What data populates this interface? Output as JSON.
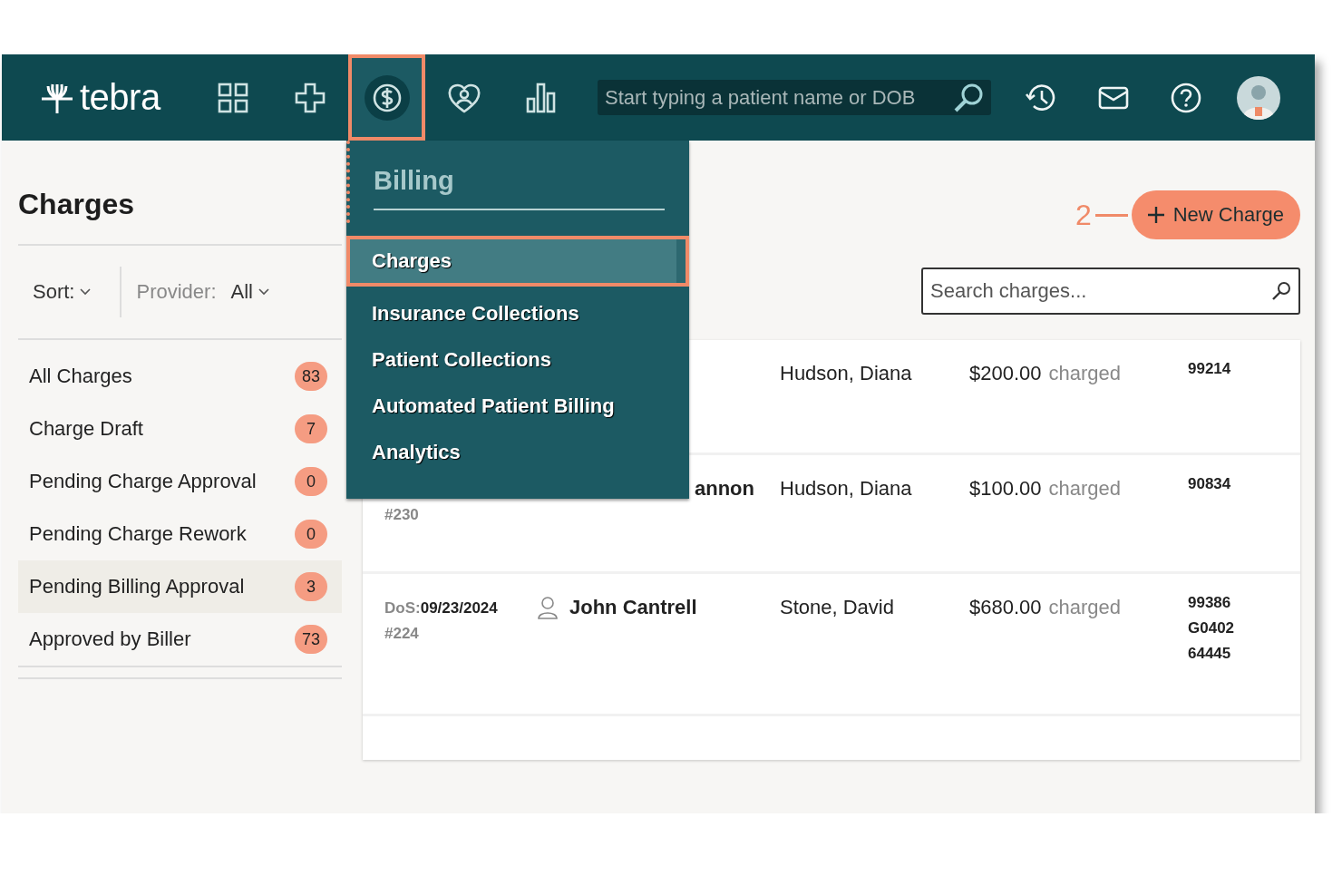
{
  "topbar": {
    "logo": "tebra",
    "nav": [
      {
        "kind": "grid",
        "selected": false
      },
      {
        "kind": "plus",
        "selected": false
      },
      {
        "kind": "dollar",
        "selected": true
      },
      {
        "kind": "heart",
        "selected": false
      },
      {
        "kind": "bars",
        "selected": false
      }
    ],
    "patient_search": {
      "placeholder": "Start typing a patient name or DOB"
    },
    "tools": [
      {
        "kind": "history"
      },
      {
        "kind": "mail"
      },
      {
        "kind": "help"
      },
      {
        "kind": "avatar"
      }
    ]
  },
  "billing_menu": {
    "title": "Billing",
    "items": [
      {
        "label": "Charges",
        "selected": true
      },
      {
        "label": "Insurance Collections",
        "selected": false
      },
      {
        "label": "Patient Collections",
        "selected": false
      },
      {
        "label": "Automated Patient Billing",
        "selected": false
      },
      {
        "label": "Analytics",
        "selected": false
      }
    ]
  },
  "page_title": "Charges",
  "sort": {
    "label": "Sort:"
  },
  "provider": {
    "label": "Provider:",
    "value": "All"
  },
  "filters": [
    {
      "label": "All Charges",
      "count": "83",
      "selected": false
    },
    {
      "label": "Charge Draft",
      "count": "7",
      "selected": false
    },
    {
      "label": "Pending Charge Approval",
      "count": "0",
      "selected": false
    },
    {
      "label": "Pending Charge Rework",
      "count": "0",
      "selected": false
    },
    {
      "label": "Pending Billing Approval",
      "count": "3",
      "selected": true
    },
    {
      "label": "Approved by Biller",
      "count": "73",
      "selected": false
    }
  ],
  "callout": "2",
  "new_charge": {
    "label": "New Charge"
  },
  "search_charges": {
    "placeholder": "Search charges..."
  },
  "charges": [
    {
      "provider": "Hudson, Diana",
      "amount": "$200.00",
      "status": "charged",
      "codes": [
        "99214"
      ]
    },
    {
      "number": "#230",
      "patient": "annon",
      "provider": "Hudson, Diana",
      "amount": "$100.00",
      "status": "charged",
      "codes": [
        "90834"
      ]
    },
    {
      "dos_label": "DoS:",
      "dos": "09/23/2024",
      "number": "#224",
      "patient": "John Cantrell",
      "provider": "Stone, David",
      "amount": "$680.00",
      "status": "charged",
      "codes": [
        "99386",
        "G0402",
        "64445"
      ]
    }
  ]
}
